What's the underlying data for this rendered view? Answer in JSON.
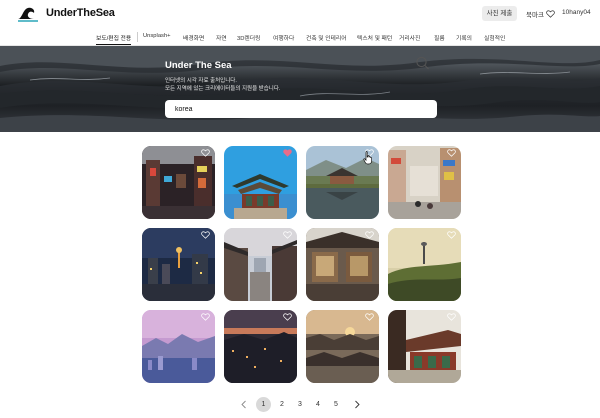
{
  "header": {
    "logo_text": "UnderTheSea",
    "submit_label": "사진 제출",
    "bookmark_label": "북마크",
    "user_name": "10hany04"
  },
  "nav": {
    "items": [
      {
        "label": "보도/편집 전용",
        "active": true
      },
      {
        "label": "Unsplash+"
      },
      {
        "label": "배경화면"
      },
      {
        "label": "자연"
      },
      {
        "label": "3D렌더링"
      },
      {
        "label": "여행하다"
      },
      {
        "label": "건축 및 인테리어"
      },
      {
        "label": "텍스처 및 패턴"
      },
      {
        "label": "거리사진"
      },
      {
        "label": "필름"
      },
      {
        "label": "기록의"
      },
      {
        "label": "실험적인"
      }
    ]
  },
  "hero": {
    "title": "Under The Sea",
    "subtitle_line1": "인터넷의 시각 자료 출처입니다.",
    "subtitle_line2": "모든 지역에 있는 크리에이터들의 지원을 받습니다."
  },
  "search": {
    "value": "korea"
  },
  "gallery": {
    "heart_filled_color": "#e86c8a",
    "heart_outline_color": "#ffffff",
    "photos": [
      {
        "subject": "night street with signs",
        "liked": false
      },
      {
        "subject": "traditional palace roof blue sky",
        "liked": true
      },
      {
        "subject": "pavilion reflected in pond",
        "liked": false
      },
      {
        "subject": "busy shopping street",
        "liked": false
      },
      {
        "subject": "city night skyline with tower",
        "liked": false
      },
      {
        "subject": "hanok alley at dusk",
        "liked": false
      },
      {
        "subject": "old storefront",
        "liked": false
      },
      {
        "subject": "tower on hill at sunset",
        "liked": false
      },
      {
        "subject": "pink sunset over mountains and city",
        "liked": false
      },
      {
        "subject": "city lights at dusk",
        "liked": false
      },
      {
        "subject": "hanok village rooftops at sunset",
        "liked": false
      },
      {
        "subject": "palace gate detail",
        "liked": false
      }
    ]
  },
  "pagination": {
    "pages": [
      "1",
      "2",
      "3",
      "4",
      "5"
    ],
    "current": "1"
  }
}
